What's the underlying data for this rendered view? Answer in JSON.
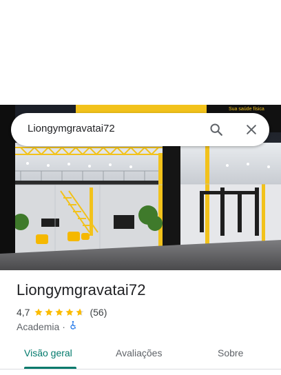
{
  "search": {
    "query": "Liongymgravatai72",
    "search_icon": "search-icon",
    "clear_icon": "close-icon"
  },
  "place": {
    "name": "Liongymgravatai72",
    "rating": "4,7",
    "rating_value": 4.7,
    "review_count": "(56)",
    "category": "Academia",
    "separator": "·",
    "accessibility_icon": "wheelchair-icon",
    "photo_sign_text": "Sua saúde física"
  },
  "tabs": [
    {
      "label": "Visão geral",
      "active": true
    },
    {
      "label": "Avaliações",
      "active": false
    },
    {
      "label": "Sobre",
      "active": false
    }
  ],
  "colors": {
    "accent": "#00796b",
    "star": "#fbbc04",
    "gym_yellow": "#f2c21b",
    "accessibility": "#1a73e8"
  }
}
